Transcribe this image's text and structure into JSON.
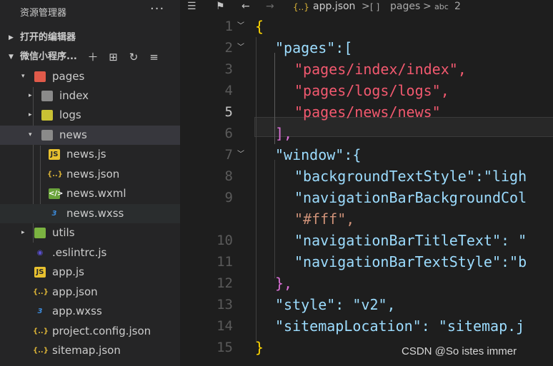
{
  "sidebar": {
    "title": "资源管理器",
    "more": "···",
    "open_editors": "打开的编辑器",
    "project": "微信小程序...",
    "tree": [
      {
        "label": "pages",
        "icon": "folder-open-icon",
        "depth": 1,
        "arrow": "▾"
      },
      {
        "label": "index",
        "icon": "folder-icon",
        "depth": 2,
        "arrow": "▸"
      },
      {
        "label": "logs",
        "icon": "folder-icon",
        "depth": 2,
        "arrow": "▸"
      },
      {
        "label": "news",
        "icon": "folder-open-icon",
        "depth": 2,
        "arrow": "▾"
      },
      {
        "label": "news.js",
        "icon": "js-file-icon",
        "depth": 3
      },
      {
        "label": "news.json",
        "icon": "json-file-icon",
        "depth": 3
      },
      {
        "label": "news.wxml",
        "icon": "wxml-file-icon",
        "depth": 3
      },
      {
        "label": "news.wxss",
        "icon": "css-file-icon",
        "depth": 3
      },
      {
        "label": "utils",
        "icon": "folder-icon",
        "depth": 1,
        "arrow": "▸"
      },
      {
        "label": ".eslintrc.js",
        "icon": "eslint-icon",
        "depth": 1
      },
      {
        "label": "app.js",
        "icon": "js-file-icon",
        "depth": 1
      },
      {
        "label": "app.json",
        "icon": "json-file-icon",
        "depth": 1
      },
      {
        "label": "app.wxss",
        "icon": "css-file-icon",
        "depth": 1
      },
      {
        "label": "project.config.json",
        "icon": "json-file-icon",
        "depth": 1
      },
      {
        "label": "sitemap.json",
        "icon": "json-file-icon",
        "depth": 1
      }
    ]
  },
  "breadcrumb": {
    "file": "app.json",
    "node": "pages",
    "index": "2",
    "sep": ">"
  },
  "editor": {
    "active_line": "5",
    "lines": [
      {
        "n": "1",
        "t": "{"
      },
      {
        "n": "2",
        "t": "\"pages\":["
      },
      {
        "n": "3",
        "t": "\"pages/index/index\","
      },
      {
        "n": "4",
        "t": "\"pages/logs/logs\","
      },
      {
        "n": "5",
        "t": "\"pages/news/news\""
      },
      {
        "n": "6",
        "t": "],"
      },
      {
        "n": "7",
        "t": "\"window\":{"
      },
      {
        "n": "8",
        "t": "\"backgroundTextStyle\":\"ligh"
      },
      {
        "n": "9",
        "t": "\"navigationBarBackgroundCol"
      },
      {
        "n": "",
        "t": "\"#fff\","
      },
      {
        "n": "10",
        "t": "\"navigationBarTitleText\": \""
      },
      {
        "n": "11",
        "t": "\"navigationBarTextStyle\":\"b"
      },
      {
        "n": "12",
        "t": "},"
      },
      {
        "n": "13",
        "t": "\"style\": \"v2\","
      },
      {
        "n": "14",
        "t": "\"sitemapLocation\": \"sitemap.j"
      },
      {
        "n": "15",
        "t": "}"
      }
    ]
  },
  "watermark": "CSDN @So istes immer",
  "colors": {
    "background": "#1e1e1e",
    "sidebar": "#252526",
    "key": "#9cdcfe",
    "string": "#ce9178",
    "page_string": "#f2596f",
    "bracket_gold": "#ffd700",
    "bracket_purple": "#da70d6"
  }
}
